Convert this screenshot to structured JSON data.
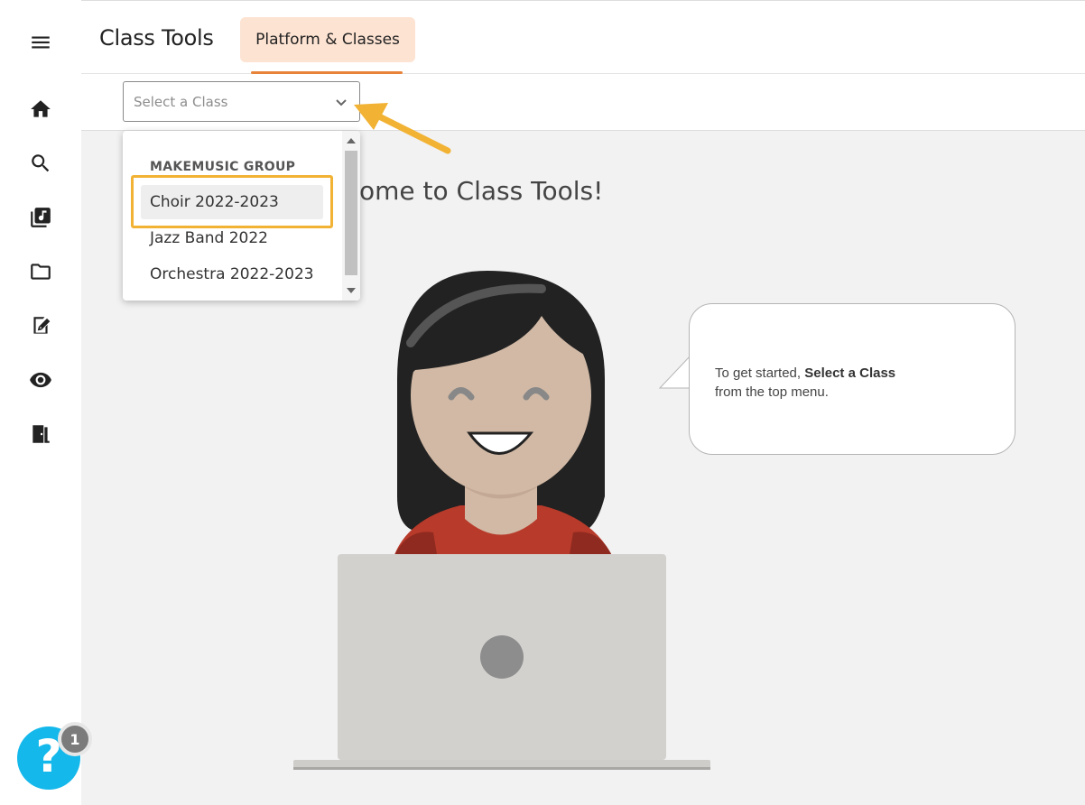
{
  "app": {
    "title": "Class Tools"
  },
  "tabs": [
    {
      "label": "Platform & Classes"
    }
  ],
  "sidebar": {
    "items": [
      {
        "icon": "menu-icon"
      },
      {
        "icon": "home-icon"
      },
      {
        "icon": "search-icon"
      },
      {
        "icon": "music-library-icon"
      },
      {
        "icon": "folder-icon"
      },
      {
        "icon": "assignment-icon"
      },
      {
        "icon": "eye-icon"
      },
      {
        "icon": "exit-door-icon"
      }
    ]
  },
  "class_select": {
    "placeholder": "Select a Class",
    "group_label": "MAKEMUSIC GROUP",
    "options": [
      "Choir 2022-2023",
      "Jazz Band 2022",
      "Orchestra 2022-2023"
    ],
    "highlighted_index": 0
  },
  "main": {
    "welcome_visible": "ome to Class Tools!"
  },
  "bubble": {
    "prefix": "To get started,",
    "bold": "Select a Class",
    "suffix": "from the top menu."
  },
  "help": {
    "label": "?",
    "badge_count": "1"
  },
  "colors": {
    "accent": "#e8833a",
    "tab_bg": "#fde3d2",
    "annotation": "#f2b233",
    "help_blue": "#14b8eb"
  }
}
